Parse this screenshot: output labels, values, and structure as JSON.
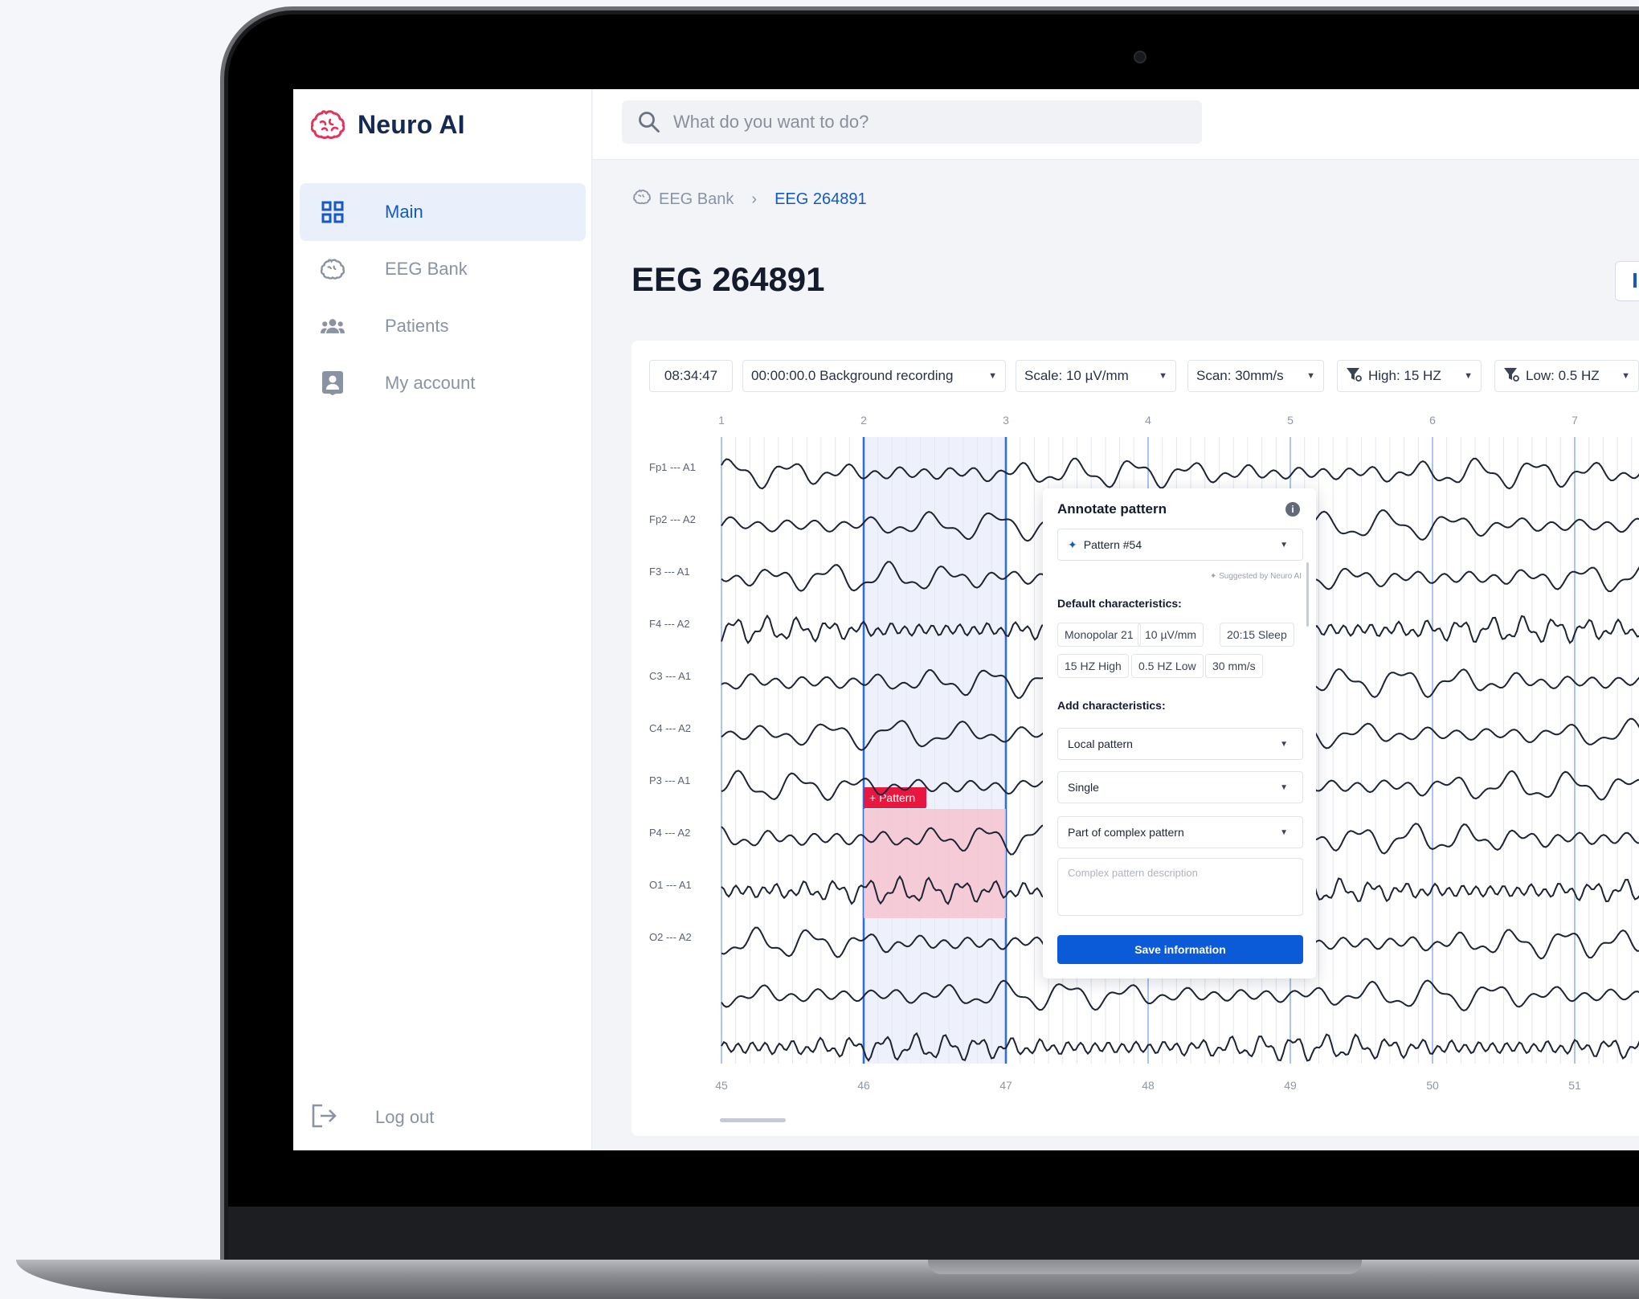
{
  "app": {
    "name": "Neuro AI"
  },
  "nav": {
    "items": [
      {
        "label": "Main",
        "icon": "grid-icon",
        "active": true
      },
      {
        "label": "EEG Bank",
        "icon": "brain-icon",
        "active": false
      },
      {
        "label": "Patients",
        "icon": "users-icon",
        "active": false
      },
      {
        "label": "My account",
        "icon": "account-icon",
        "active": false
      }
    ],
    "logout": "Log out"
  },
  "search": {
    "placeholder": "What do you want to do?"
  },
  "breadcrumb": {
    "parent": "EEG Bank",
    "current": "EEG 264891"
  },
  "page": {
    "title": "EEG 264891"
  },
  "toolbar": {
    "time": "08:34:47",
    "recording": "00:00:00.0 Background recording",
    "scale": "Scale: 10 µV/mm",
    "scan": "Scan: 30mm/s",
    "high": "High: 15 HZ",
    "low": "Low: 0.5 HZ"
  },
  "eeg": {
    "top_ticks": [
      "1",
      "2",
      "3",
      "4",
      "5",
      "6",
      "7"
    ],
    "bottom_ticks": [
      "45",
      "46",
      "47",
      "48",
      "49",
      "50",
      "51"
    ],
    "channels": [
      "Fp1 --- A1",
      "Fp2 --- A2",
      "F3 --- A1",
      "F4 --- A2",
      "C3 --- A1",
      "C4 --- A2",
      "P3 --- A1",
      "P4 --- A2",
      "O1 --- A1",
      "O2 --- A2"
    ],
    "pattern_tag": "+ Pattern"
  },
  "annotate": {
    "title": "Annotate pattern",
    "selected_pattern": "Pattern #54",
    "suggested_by": "Suggested by Neuro AI",
    "default_label": "Default characteristics:",
    "default_tags": [
      "Monopolar 21",
      "10 µV/mm",
      "20:15 Sleep",
      "15 HZ High",
      "0.5 HZ Low",
      "30 mm/s"
    ],
    "add_label": "Add characteristics:",
    "selects": [
      "Local pattern",
      "Single",
      "Part of complex pattern"
    ],
    "description_placeholder": "Complex pattern description",
    "save_label": "Save information"
  },
  "colors": {
    "accent": "#1658c4",
    "pattern": "#e8173f",
    "trace": "#1c2333",
    "selection": "#eef0fb"
  }
}
